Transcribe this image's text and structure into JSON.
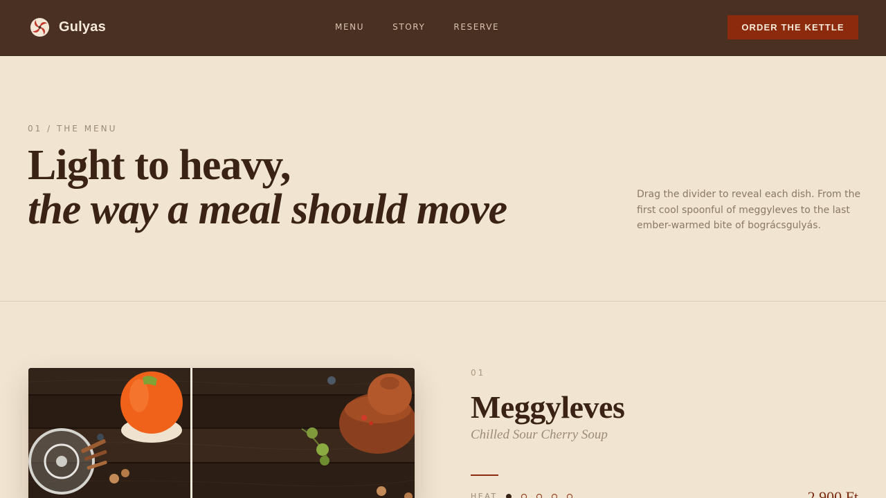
{
  "header": {
    "brand": "Gulyas",
    "nav": [
      "MENU",
      "STORY",
      "RESERVE"
    ],
    "cta_label": "ORDER THE KETTLE"
  },
  "hero": {
    "eyebrow": "01 / THE MENU",
    "headline_line1": "Light to heavy,",
    "headline_line2": "the way a meal should move",
    "lede": "Drag the divider to reveal each dish. From the first cool spoonful of meggyleves to the last ember-warmed bite of bográcsgulyás."
  },
  "dish": {
    "number": "01",
    "name": "Meggyleves",
    "subtitle": "Chilled Sour Cherry Soup",
    "heat_label": "HEAT",
    "heat_level": 1,
    "heat_max": 5,
    "price": "2 900 Ft",
    "divider_position_fraction": 0.42
  },
  "colors": {
    "header_bg": "#4a3023",
    "page_bg": "#f1e5d2",
    "accent": "#8b2a0c"
  }
}
